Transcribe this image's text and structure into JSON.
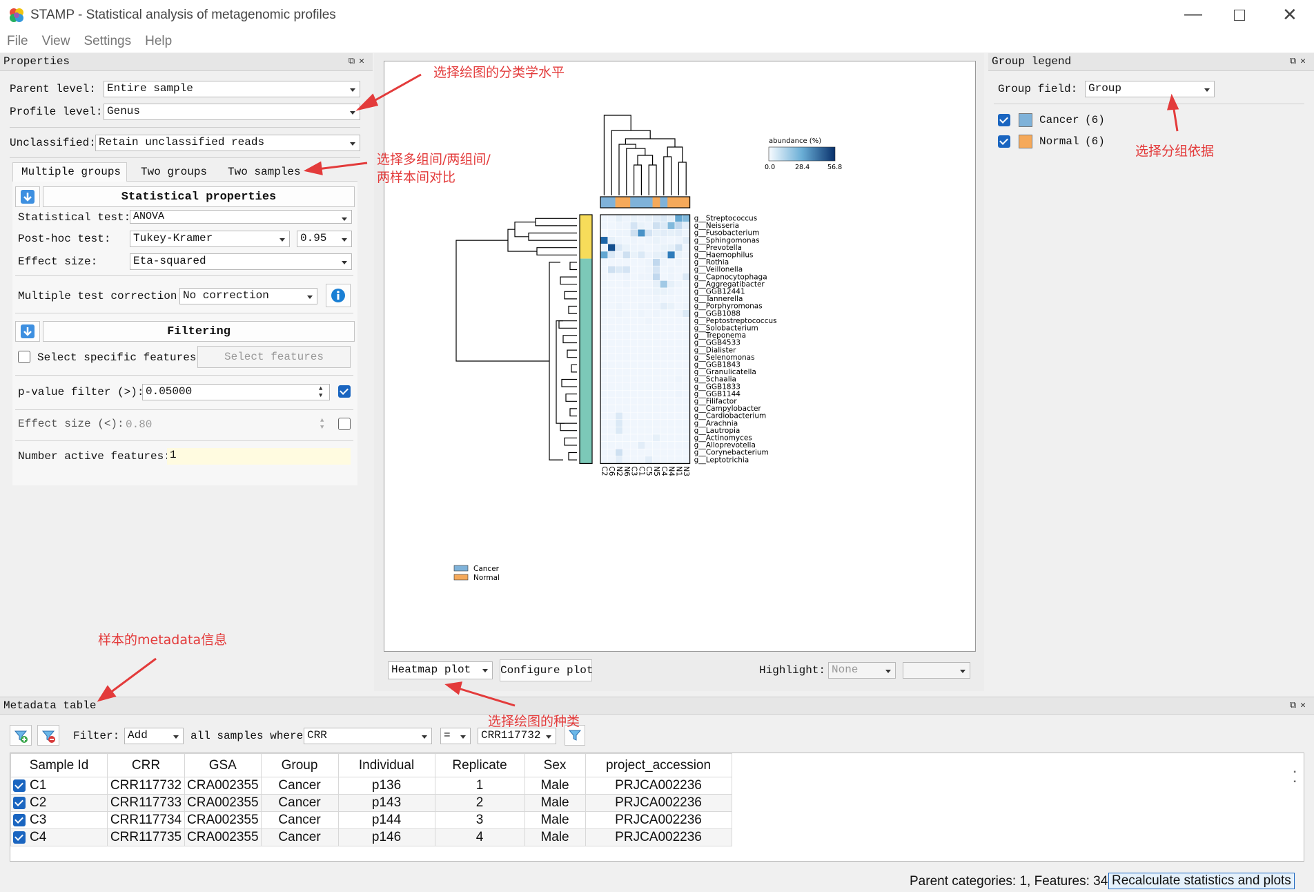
{
  "window": {
    "title": "STAMP - Statistical analysis of metagenomic profiles"
  },
  "menu": [
    "File",
    "View",
    "Settings",
    "Help"
  ],
  "properties": {
    "header": "Properties",
    "parent_level_label": "Parent level:",
    "parent_level_value": "Entire sample",
    "profile_level_label": "Profile level:",
    "profile_level_value": "Genus",
    "unclassified_label": "Unclassified:",
    "unclassified_value": "Retain unclassified reads",
    "tabs": [
      "Multiple groups",
      "Two groups",
      "Two samples"
    ],
    "stat_header": "Statistical properties",
    "stat_test_label": "Statistical test:",
    "stat_test_value": "ANOVA",
    "posthoc_label": "Post-hoc test:",
    "posthoc_value": "Tukey-Kramer",
    "posthoc_conf": "0.95",
    "effect_label": "Effect size:",
    "effect_value": "Eta-squared",
    "mtc_label": "Multiple test correction:",
    "mtc_value": "No correction",
    "filter_header": "Filtering",
    "select_features_label": "Select specific features",
    "select_features_button": "Select features",
    "pvalue_label": "p-value filter (>):",
    "pvalue_value": "0.05000",
    "effsize_label": "Effect size (<):",
    "effsize_value": "0.80",
    "active_label": "Number active features:",
    "active_value": "1"
  },
  "plot": {
    "type_value": "Heatmap plot",
    "configure": "Configure plot",
    "highlight_label": "Highlight:",
    "highlight_value": "None",
    "legend_title": "abundance (%)",
    "legend_ticks": [
      "0.0",
      "28.4",
      "56.8"
    ],
    "group_legend": [
      "Cancer",
      "Normal"
    ]
  },
  "chart_data": {
    "type": "heatmap",
    "title": "",
    "color_scale_label": "abundance (%)",
    "scale_range": [
      0.0,
      56.8
    ],
    "columns": [
      "C2",
      "C6",
      "N2",
      "N6",
      "C3",
      "C1",
      "C5",
      "N5",
      "C4",
      "N4",
      "N1",
      "N3"
    ],
    "column_groups": [
      "Cancer",
      "Cancer",
      "Normal",
      "Normal",
      "Cancer",
      "Cancer",
      "Cancer",
      "Normal",
      "Cancer",
      "Normal",
      "Normal",
      "Normal"
    ],
    "rows": [
      "g__Streptococcus",
      "g__Neisseria",
      "g__Fusobacterium",
      "g__Sphingomonas",
      "g__Prevotella",
      "g__Haemophilus",
      "g__Rothia",
      "g__Veillonella",
      "g__Capnocytophaga",
      "g__Aggregatibacter",
      "g__GGB12441",
      "g__Tannerella",
      "g__Porphyromonas",
      "g__GGB1088",
      "g__Peptostreptococcus",
      "g__Solobacterium",
      "g__Treponema",
      "g__GGB4533",
      "g__Dialister",
      "g__Selenomonas",
      "g__GGB1843",
      "g__Granulicatella",
      "g__Schaalia",
      "g__GGB1833",
      "g__GGB1144",
      "g__Filifactor",
      "g__Campylobacter",
      "g__Cardiobacterium",
      "g__Arachnia",
      "g__Lautropia",
      "g__Actinomyces",
      "g__Alloprevotella",
      "g__Corynebacterium",
      "g__Leptotrichia"
    ],
    "values": [
      [
        2,
        2,
        5,
        3,
        4,
        3,
        4,
        6,
        8,
        5,
        30,
        25
      ],
      [
        2,
        2,
        3,
        3,
        10,
        4,
        3,
        12,
        8,
        25,
        15,
        6
      ],
      [
        1,
        2,
        3,
        3,
        12,
        35,
        10,
        5,
        6,
        5,
        6,
        3
      ],
      [
        45,
        5,
        3,
        2,
        3,
        2,
        3,
        4,
        3,
        2,
        3,
        6
      ],
      [
        3,
        50,
        8,
        4,
        3,
        3,
        2,
        3,
        4,
        5,
        12,
        2
      ],
      [
        30,
        8,
        3,
        12,
        4,
        8,
        3,
        5,
        6,
        40,
        4,
        2
      ],
      [
        2,
        2,
        2,
        2,
        2,
        2,
        3,
        15,
        3,
        2,
        3,
        2
      ],
      [
        2,
        12,
        8,
        10,
        2,
        2,
        3,
        10,
        2,
        3,
        2,
        2
      ],
      [
        2,
        2,
        2,
        3,
        2,
        3,
        3,
        15,
        2,
        3,
        2,
        8
      ],
      [
        2,
        2,
        2,
        3,
        2,
        2,
        2,
        5,
        20,
        5,
        3,
        2
      ],
      [
        2,
        2,
        2,
        2,
        2,
        3,
        3,
        4,
        4,
        3,
        2,
        2
      ],
      [
        2,
        2,
        2,
        2,
        2,
        2,
        2,
        3,
        2,
        2,
        2,
        2
      ],
      [
        2,
        2,
        3,
        2,
        2,
        3,
        3,
        3,
        6,
        4,
        2,
        3
      ],
      [
        2,
        2,
        3,
        2,
        2,
        3,
        2,
        3,
        2,
        2,
        3,
        8
      ],
      [
        2,
        2,
        2,
        2,
        2,
        2,
        3,
        2,
        2,
        2,
        2,
        2
      ],
      [
        2,
        2,
        2,
        2,
        2,
        2,
        2,
        2,
        2,
        2,
        2,
        2
      ],
      [
        2,
        2,
        2,
        2,
        2,
        2,
        2,
        2,
        2,
        2,
        2,
        2
      ],
      [
        2,
        2,
        2,
        2,
        2,
        2,
        2,
        2,
        2,
        2,
        2,
        2
      ],
      [
        2,
        2,
        2,
        2,
        2,
        2,
        2,
        2,
        2,
        2,
        2,
        2
      ],
      [
        2,
        2,
        2,
        2,
        2,
        2,
        2,
        2,
        2,
        2,
        2,
        2
      ],
      [
        2,
        2,
        2,
        2,
        2,
        2,
        2,
        2,
        2,
        2,
        2,
        2
      ],
      [
        2,
        2,
        2,
        2,
        2,
        2,
        2,
        2,
        2,
        2,
        2,
        2
      ],
      [
        2,
        2,
        2,
        2,
        2,
        2,
        2,
        2,
        2,
        2,
        3,
        2
      ],
      [
        2,
        2,
        2,
        2,
        2,
        2,
        2,
        2,
        2,
        2,
        2,
        2
      ],
      [
        2,
        2,
        2,
        2,
        2,
        2,
        2,
        2,
        2,
        2,
        3,
        2
      ],
      [
        2,
        2,
        2,
        2,
        2,
        2,
        2,
        2,
        2,
        2,
        2,
        2
      ],
      [
        2,
        2,
        2,
        2,
        2,
        2,
        2,
        2,
        2,
        2,
        2,
        2
      ],
      [
        2,
        2,
        8,
        2,
        2,
        2,
        2,
        2,
        2,
        2,
        2,
        2
      ],
      [
        2,
        2,
        8,
        2,
        2,
        2,
        2,
        2,
        2,
        2,
        2,
        2
      ],
      [
        2,
        2,
        8,
        2,
        2,
        2,
        2,
        2,
        2,
        2,
        2,
        2
      ],
      [
        2,
        2,
        2,
        2,
        2,
        2,
        2,
        5,
        2,
        2,
        2,
        2
      ],
      [
        2,
        2,
        2,
        2,
        2,
        6,
        2,
        2,
        2,
        2,
        2,
        2
      ],
      [
        2,
        2,
        12,
        2,
        2,
        2,
        2,
        2,
        2,
        2,
        2,
        2
      ],
      [
        2,
        2,
        6,
        2,
        2,
        2,
        6,
        2,
        2,
        2,
        2,
        2
      ]
    ]
  },
  "group_legend": {
    "header": "Group legend",
    "field_label": "Group field:",
    "field_value": "Group",
    "items": [
      {
        "name": "Cancer",
        "count": "(6)",
        "color": "#7fb2d9"
      },
      {
        "name": "Normal",
        "count": "(6)",
        "color": "#f5a95a"
      }
    ]
  },
  "metadata": {
    "header": "Metadata table",
    "filter_label": "Filter:",
    "filter_mode": "Add",
    "where_text": "all samples where",
    "field": "CRR",
    "op": "=",
    "value": "CRR117732",
    "columns": [
      "Sample Id",
      "CRR",
      "GSA",
      "Group",
      "Individual",
      "Replicate",
      "Sex",
      "project_accession"
    ],
    "rows": [
      [
        "C1",
        "CRR117732",
        "CRA002355",
        "Cancer",
        "p136",
        "1",
        "Male",
        "PRJCA002236"
      ],
      [
        "C2",
        "CRR117733",
        "CRA002355",
        "Cancer",
        "p143",
        "2",
        "Male",
        "PRJCA002236"
      ],
      [
        "C3",
        "CRR117734",
        "CRA002355",
        "Cancer",
        "p144",
        "3",
        "Male",
        "PRJCA002236"
      ],
      [
        "C4",
        "CRR117735",
        "CRA002355",
        "Cancer",
        "p146",
        "4",
        "Male",
        "PRJCA002236"
      ]
    ]
  },
  "status": {
    "text": "Parent categories: 1, Features: 34",
    "recalc": "Recalculate statistics and plots"
  },
  "annotations": {
    "a1": "选择绘图的分类学水平",
    "a2_line1": "选择多组间/两组间/",
    "a2_line2": "两样本间对比",
    "a3": "选择分组依据",
    "a4": "样本的metadata信息",
    "a5": "选择绘图的种类"
  }
}
